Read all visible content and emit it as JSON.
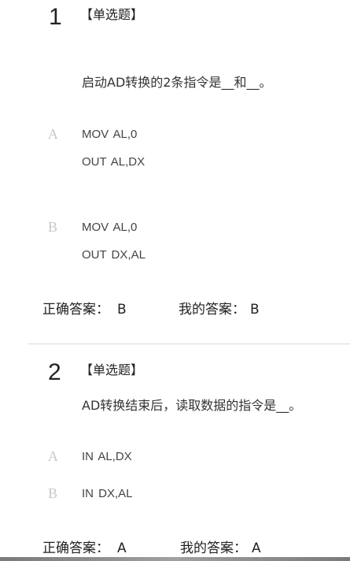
{
  "questions": [
    {
      "number": "1",
      "type_label": "【单选题】",
      "stem": "启动AD转换的2条指令是__和__。",
      "options": [
        {
          "letter": "A",
          "lines": [
            "MOV  AL,0",
            "OUT AL,DX"
          ]
        },
        {
          "letter": "B",
          "lines": [
            "MOV  AL,0",
            "OUT DX,AL"
          ]
        }
      ],
      "correct_label": "正确答案：",
      "correct_value": "B",
      "my_label": "我的答案：",
      "my_value": "B"
    },
    {
      "number": "2",
      "type_label": "【单选题】",
      "stem": "AD转换结束后，读取数据的指令是__。",
      "options": [
        {
          "letter": "A",
          "lines": [
            "IN  AL,DX"
          ]
        },
        {
          "letter": "B",
          "lines": [
            "IN  DX,AL"
          ]
        }
      ],
      "correct_label": "正确答案：",
      "correct_value": "A",
      "my_label": "我的答案：",
      "my_value": "A"
    }
  ]
}
